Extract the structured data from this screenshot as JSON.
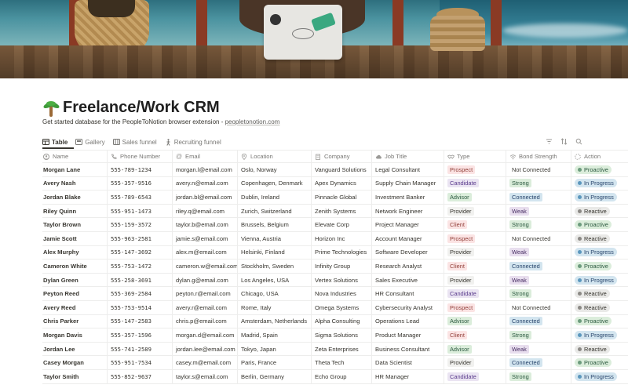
{
  "page": {
    "title": "Freelance/Work CRM",
    "subtitle_text": "Get started database for the PeopleToNotion browser extension - ",
    "subtitle_link": "peopletonotion.com"
  },
  "tabs": [
    {
      "label": "Table",
      "icon": "table-icon",
      "active": true
    },
    {
      "label": "Gallery",
      "icon": "gallery-icon",
      "active": false
    },
    {
      "label": "Sales funnel",
      "icon": "board-icon",
      "active": false
    },
    {
      "label": "Recruiting funnel",
      "icon": "person-walking-icon",
      "active": false
    }
  ],
  "toolbar_icons": [
    "filter-icon",
    "sort-icon",
    "search-icon"
  ],
  "columns": [
    {
      "label": "Name",
      "icon": "person-circle-icon"
    },
    {
      "label": "Phone Number",
      "icon": "phone-icon"
    },
    {
      "label": "Email",
      "icon": "at-icon"
    },
    {
      "label": "Location",
      "icon": "location-pin-icon"
    },
    {
      "label": "Company",
      "icon": "building-icon"
    },
    {
      "label": "Job Title",
      "icon": "cloud-icon"
    },
    {
      "label": "Type",
      "icon": "handshake-icon"
    },
    {
      "label": "Bond Strength",
      "icon": "signal-icon"
    },
    {
      "label": "Action",
      "icon": "status-dashed-circle-icon"
    }
  ],
  "type_colors": {
    "Prospect": {
      "bg": "#fbe4e4",
      "fg": "#93413b"
    },
    "Candidate": {
      "bg": "#eae4f2",
      "fg": "#5a3b8c"
    },
    "Advisor": {
      "bg": "#dbeddb",
      "fg": "#2b593f"
    },
    "Provider": {
      "bg": "#f1f1ef",
      "fg": "#37352f"
    },
    "Client": {
      "bg": "#fbe4e4",
      "fg": "#93413b"
    }
  },
  "bond_colors": {
    "Not Connected": {
      "bg": "transparent",
      "fg": "#37352f"
    },
    "Strong": {
      "bg": "#dbeddb",
      "fg": "#2b593f"
    },
    "Connected": {
      "bg": "#d3e5ef",
      "fg": "#28456c"
    },
    "Weak": {
      "bg": "#e8deee",
      "fg": "#492f64"
    }
  },
  "action_colors": {
    "Proactive": {
      "bg": "#dbeddb",
      "fg": "#2b593f",
      "dot": "#6c9b7d"
    },
    "In Progress": {
      "bg": "#d3e5ef",
      "fg": "#28456c",
      "dot": "#5b97bd"
    },
    "Reactive": {
      "bg": "#e9e9e7",
      "fg": "#37352f",
      "dot": "#8b8985"
    }
  },
  "rows": [
    {
      "name": "Morgan Lane",
      "phone": "555-789-1234",
      "email": "morgan.l@email.com",
      "location": "Oslo, Norway",
      "company": "Vanguard Solutions",
      "job": "Legal Consultant",
      "type": "Prospect",
      "bond": "Not Connected",
      "action": "Proactive"
    },
    {
      "name": "Avery Nash",
      "phone": "555-357-9516",
      "email": "avery.n@email.com",
      "location": "Copenhagen, Denmark",
      "company": "Apex Dynamics",
      "job": "Supply Chain Manager",
      "type": "Candidate",
      "bond": "Strong",
      "action": "In Progress"
    },
    {
      "name": "Jordan Blake",
      "phone": "555-789-6543",
      "email": "jordan.bl@email.com",
      "location": "Dublin, Ireland",
      "company": "Pinnacle Global",
      "job": "Investment Banker",
      "type": "Advisor",
      "bond": "Connected",
      "action": "In Progress"
    },
    {
      "name": "Riley Quinn",
      "phone": "555-951-1473",
      "email": "riley.q@email.com",
      "location": "Zurich, Switzerland",
      "company": "Zenith Systems",
      "job": "Network Engineer",
      "type": "Provider",
      "bond": "Weak",
      "action": "Reactive"
    },
    {
      "name": "Taylor Brown",
      "phone": "555-159-3572",
      "email": "taylor.b@email.com",
      "location": "Brussels, Belgium",
      "company": "Elevate Corp",
      "job": "Project Manager",
      "type": "Client",
      "bond": "Strong",
      "action": "Proactive"
    },
    {
      "name": "Jamie Scott",
      "phone": "555-963-2581",
      "email": "jamie.s@email.com",
      "location": "Vienna, Austria",
      "company": "Horizon Inc",
      "job": "Account Manager",
      "type": "Prospect",
      "bond": "Not Connected",
      "action": "Reactive"
    },
    {
      "name": "Alex Murphy",
      "phone": "555-147-3692",
      "email": "alex.m@email.com",
      "location": "Helsinki, Finland",
      "company": "Prime Technologies",
      "job": "Software Developer",
      "type": "Provider",
      "bond": "Weak",
      "action": "In Progress"
    },
    {
      "name": "Cameron White",
      "phone": "555-753-1472",
      "email": "cameron.w@email.com",
      "location": "Stockholm, Sweden",
      "company": "Infinity Group",
      "job": "Research Analyst",
      "type": "Client",
      "bond": "Connected",
      "action": "Proactive"
    },
    {
      "name": "Dylan Green",
      "phone": "555-258-3691",
      "email": "dylan.g@email.com",
      "location": "Los Angeles, USA",
      "company": "Vertex Solutions",
      "job": "Sales Executive",
      "type": "Provider",
      "bond": "Weak",
      "action": "In Progress"
    },
    {
      "name": "Peyton Reed",
      "phone": "555-369-2584",
      "email": "peyton.r@email.com",
      "location": "Chicago, USA",
      "company": "Nova Industries",
      "job": "HR Consultant",
      "type": "Candidate",
      "bond": "Strong",
      "action": "Reactive"
    },
    {
      "name": "Avery Reed",
      "phone": "555-753-9514",
      "email": "avery.r@email.com",
      "location": "Rome, Italy",
      "company": "Omega Systems",
      "job": "Cybersecurity Analyst",
      "type": "Prospect",
      "bond": "Not Connected",
      "action": "Reactive"
    },
    {
      "name": "Chris Parker",
      "phone": "555-147-2583",
      "email": "chris.p@email.com",
      "location": "Amsterdam, Netherlands",
      "company": "Alpha Consulting",
      "job": "Operations Lead",
      "type": "Advisor",
      "bond": "Connected",
      "action": "Proactive"
    },
    {
      "name": "Morgan Davis",
      "phone": "555-357-1596",
      "email": "morgan.d@email.com",
      "location": "Madrid, Spain",
      "company": "Sigma Solutions",
      "job": "Product Manager",
      "type": "Client",
      "bond": "Strong",
      "action": "In Progress"
    },
    {
      "name": "Jordan Lee",
      "phone": "555-741-2589",
      "email": "jordan.lee@email.com",
      "location": "Tokyo, Japan",
      "company": "Zeta Enterprises",
      "job": "Business Consultant",
      "type": "Advisor",
      "bond": "Weak",
      "action": "Reactive"
    },
    {
      "name": "Casey Morgan",
      "phone": "555-951-7534",
      "email": "casey.m@email.com",
      "location": "Paris, France",
      "company": "Theta Tech",
      "job": "Data Scientist",
      "type": "Provider",
      "bond": "Connected",
      "action": "Proactive"
    },
    {
      "name": "Taylor Smith",
      "phone": "555-852-9637",
      "email": "taylor.s@email.com",
      "location": "Berlin, Germany",
      "company": "Echo Group",
      "job": "HR Manager",
      "type": "Candidate",
      "bond": "Strong",
      "action": "In Progress"
    }
  ]
}
